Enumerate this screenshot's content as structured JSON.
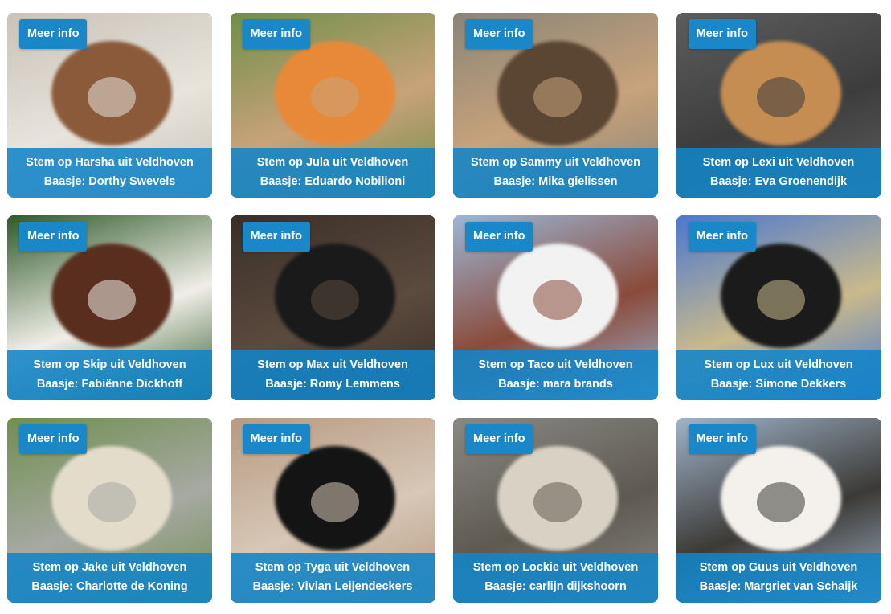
{
  "button_label": "Meer info",
  "cards": [
    {
      "title": "Stem op Harsha uit Veldhoven",
      "owner": "Baasje: Dorthy Swevels",
      "palette": [
        "#c9c3b8",
        "#8b5a3a",
        "#e8e4dc"
      ]
    },
    {
      "title": "Stem op Jula uit Veldhoven",
      "owner": "Baasje: Eduardo Nobilioni",
      "palette": [
        "#6f8f4a",
        "#e8893a",
        "#c9a27a"
      ]
    },
    {
      "title": "Stem op Sammy uit Veldhoven",
      "owner": "Baasje: Mika gielissen",
      "palette": [
        "#8a8578",
        "#5b4634",
        "#c7a27b"
      ]
    },
    {
      "title": "Stem op Lexi uit Veldhoven",
      "owner": "Baasje: Eva Groenendijk",
      "palette": [
        "#5d5d5d",
        "#c68d52",
        "#3d3d3d"
      ]
    },
    {
      "title": "Stem op Skip uit Veldhoven",
      "owner": "Baasje: Fabiënne Dickhoff",
      "palette": [
        "#2f5a2a",
        "#5a2e1e",
        "#f1eee8"
      ]
    },
    {
      "title": "Stem op Max uit Veldhoven",
      "owner": "Baasje: Romy Lemmens",
      "palette": [
        "#3a2f28",
        "#1a1a1a",
        "#5b4a3e"
      ]
    },
    {
      "title": "Stem op Taco uit Veldhoven",
      "owner": "Baasje: mara brands",
      "palette": [
        "#9cb7d6",
        "#f2f2f2",
        "#8a4a3a"
      ]
    },
    {
      "title": "Stem op Lux uit Veldhoven",
      "owner": "Baasje: Simone Dekkers",
      "palette": [
        "#4a78d0",
        "#1b1b1b",
        "#c9b98c"
      ]
    },
    {
      "title": "Stem op Jake uit Veldhoven",
      "owner": "Baasje: Charlotte de Koning",
      "palette": [
        "#6f8f4f",
        "#e3dccb",
        "#a7a9a3"
      ]
    },
    {
      "title": "Stem op Tyga uit Veldhoven",
      "owner": "Baasje: Vivian Leijendeckers",
      "palette": [
        "#b79a82",
        "#141414",
        "#d7c7b6"
      ]
    },
    {
      "title": "Stem op Lockie uit Veldhoven",
      "owner": "Baasje: carlijn dijkshoorn",
      "palette": [
        "#8a8883",
        "#d9d2c4",
        "#5e5a52"
      ]
    },
    {
      "title": "Stem op Guus uit Veldhoven",
      "owner": "Baasje: Margriet van Schaijk",
      "palette": [
        "#9fb3c9",
        "#f4f1ec",
        "#3c3a36"
      ]
    }
  ]
}
